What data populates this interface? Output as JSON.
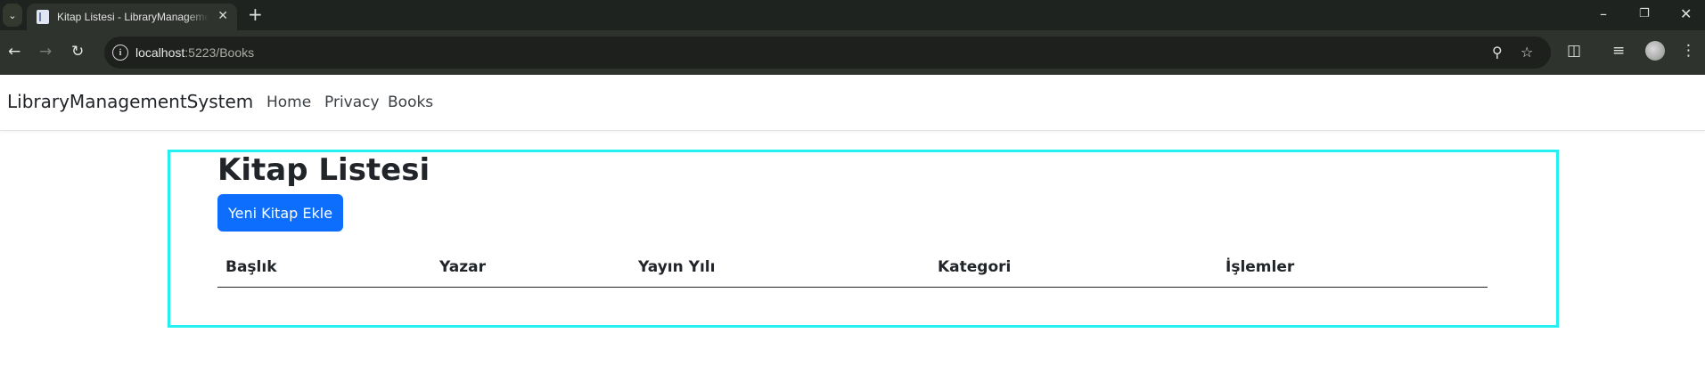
{
  "browser": {
    "tab_title": "Kitap Listesi - LibraryManagementSystem",
    "url_host": "localhost",
    "url_rest": ":5223/Books"
  },
  "navbar": {
    "brand": "LibraryManagementSystem",
    "links": [
      "Home",
      "Privacy",
      "Books"
    ]
  },
  "main": {
    "title": "Kitap Listesi",
    "add_button": "Yeni Kitap Ekle",
    "table_headers": [
      "Başlık",
      "Yazar",
      "Yayın Yılı",
      "Kategori",
      "İşlemler"
    ]
  },
  "colors": {
    "primary_button": "#0d6efd",
    "highlight_border": "#24f0f0"
  }
}
